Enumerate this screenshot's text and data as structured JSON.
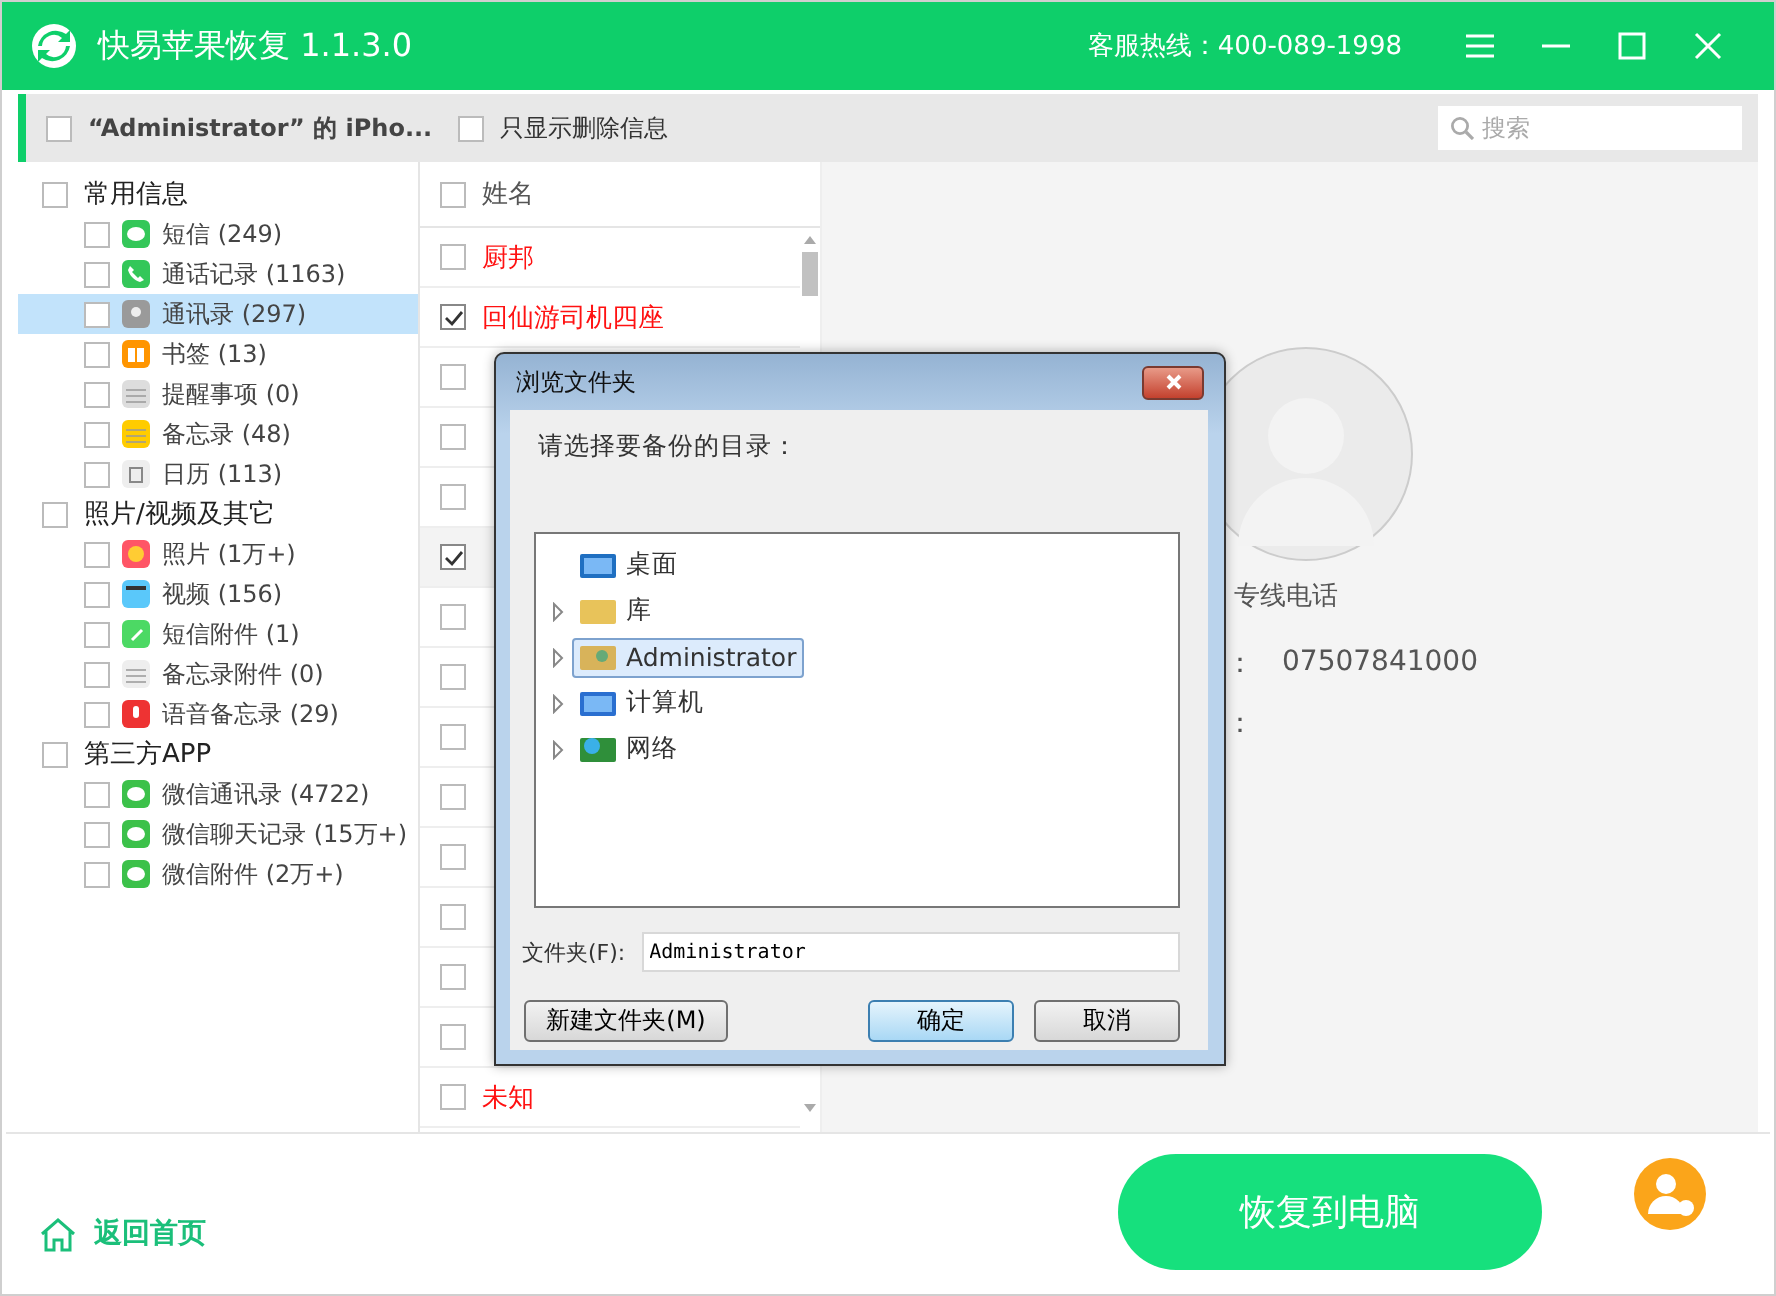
{
  "window": {
    "title": "快易苹果恢复 1.1.3.0",
    "hotline": "客服热线：400-089-1998"
  },
  "header": {
    "device": {
      "label": "“Administrator” 的 iPho...",
      "checked": false
    },
    "deleted_only": {
      "label": "只显示删除信息",
      "checked": false
    },
    "search": {
      "placeholder": "搜索"
    }
  },
  "sidebar": {
    "groups": [
      {
        "label": "常用信息",
        "checked": false,
        "items": [
          {
            "label": "短信 (249)",
            "kind": "messages",
            "checked": false,
            "selected": false
          },
          {
            "label": "通话记录 (1163)",
            "kind": "phone",
            "checked": false,
            "selected": false
          },
          {
            "label": "通讯录 (297)",
            "kind": "contacts",
            "checked": false,
            "selected": true
          },
          {
            "label": "书签 (13)",
            "kind": "bookmark",
            "checked": false,
            "selected": false
          },
          {
            "label": "提醒事项 (0)",
            "kind": "reminder",
            "checked": false,
            "selected": false
          },
          {
            "label": "备忘录 (48)",
            "kind": "notes",
            "checked": false,
            "selected": false
          },
          {
            "label": "日历 (113)",
            "kind": "calendar",
            "checked": false,
            "selected": false
          }
        ]
      },
      {
        "label": "照片/视频及其它",
        "checked": false,
        "items": [
          {
            "label": "照片 (1万+)",
            "kind": "photos",
            "checked": false,
            "selected": false
          },
          {
            "label": "视频 (156)",
            "kind": "video",
            "checked": false,
            "selected": false
          },
          {
            "label": "短信附件 (1)",
            "kind": "attachment",
            "checked": false,
            "selected": false
          },
          {
            "label": "备忘录附件 (0)",
            "kind": "note-attachment",
            "checked": false,
            "selected": false
          },
          {
            "label": "语音备忘录 (29)",
            "kind": "voice",
            "checked": false,
            "selected": false
          }
        ]
      },
      {
        "label": "第三方APP",
        "checked": false,
        "items": [
          {
            "label": "微信通讯录 (4722)",
            "kind": "wechat",
            "checked": false,
            "selected": false
          },
          {
            "label": "微信聊天记录 (15万+)",
            "kind": "wechat",
            "checked": false,
            "selected": false
          },
          {
            "label": "微信附件 (2万+)",
            "kind": "wechat",
            "checked": false,
            "selected": false
          }
        ]
      }
    ]
  },
  "contacts": {
    "header": {
      "label": "姓名",
      "checked": false
    },
    "rows": [
      {
        "name": "厨邦",
        "checked": false,
        "selected": false
      },
      {
        "name": "回仙游司机四座",
        "checked": true,
        "selected": false
      },
      {
        "checked": false,
        "selected": false
      },
      {
        "checked": false,
        "selected": false
      },
      {
        "checked": false,
        "selected": false
      },
      {
        "checked": true,
        "selected": true
      },
      {
        "checked": false,
        "selected": false
      },
      {
        "checked": false,
        "selected": false
      },
      {
        "checked": false,
        "selected": false
      },
      {
        "checked": false,
        "selected": false
      },
      {
        "checked": false,
        "selected": false
      },
      {
        "checked": false,
        "selected": false
      },
      {
        "checked": false,
        "selected": false
      },
      {
        "checked": false,
        "selected": false
      },
      {
        "name": "未知",
        "checked": false,
        "selected": false
      }
    ]
  },
  "detail": {
    "name": "专线电话",
    "fields": [
      {
        "colon": "：",
        "value": "07507841000"
      },
      {
        "colon": "："
      }
    ]
  },
  "dialog": {
    "title": "浏览文件夹",
    "prompt": "请选择要备份的目录：",
    "tree": [
      {
        "label": "桌面",
        "kind": "desktop",
        "expander": false,
        "selected": false
      },
      {
        "label": "库",
        "kind": "library",
        "expander": true,
        "selected": false
      },
      {
        "label": "Administrator",
        "kind": "user",
        "expander": true,
        "selected": true
      },
      {
        "label": "计算机",
        "kind": "computer",
        "expander": true,
        "selected": false
      },
      {
        "label": "网络",
        "kind": "network",
        "expander": true,
        "selected": false
      }
    ],
    "folder_label": "文件夹(F):",
    "folder_value": "Administrator",
    "buttons": [
      {
        "label": "新建文件夹(M)",
        "default": false
      },
      {
        "label": "确定",
        "default": true
      },
      {
        "label": "取消",
        "default": false
      }
    ]
  },
  "footer": {
    "home": "返回首页",
    "restore": "恢复到电脑"
  }
}
